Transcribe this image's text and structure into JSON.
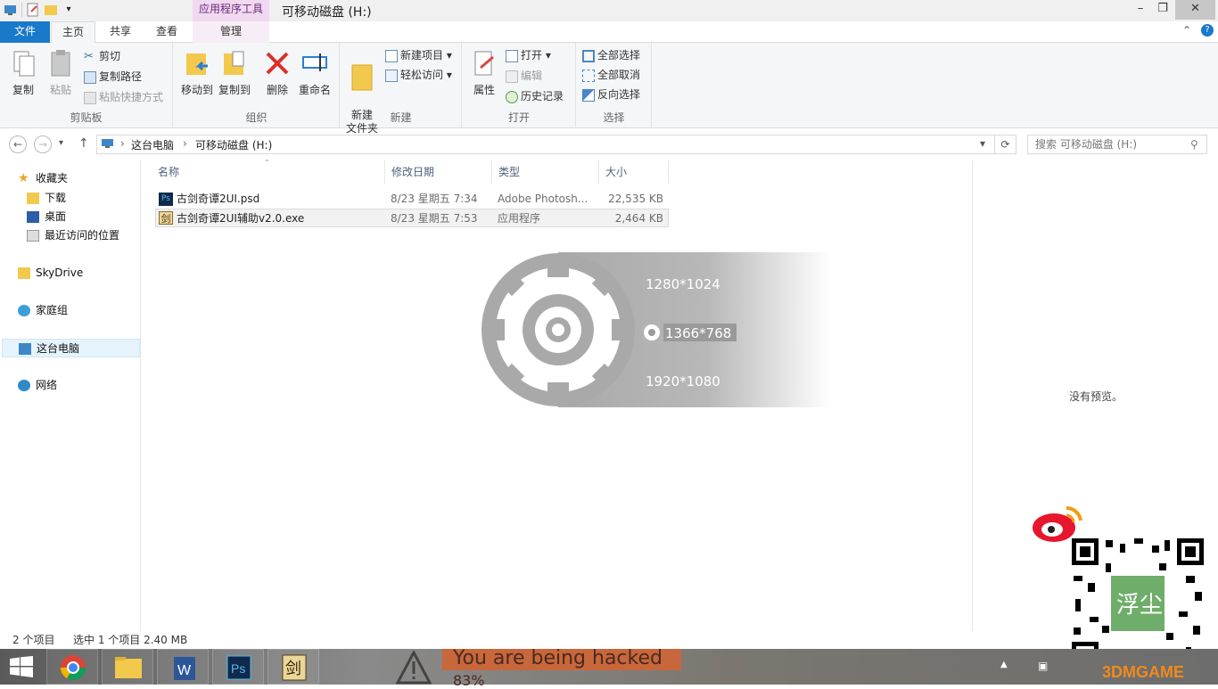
{
  "window": {
    "title": "可移动磁盘 (H:)",
    "context_tab_group": "应用程序工具",
    "minimize": "–",
    "maximize": "❐",
    "close": "✕"
  },
  "tabs": {
    "file": "文件",
    "home": "主页",
    "share": "共享",
    "view": "查看",
    "manage": "管理"
  },
  "ribbon": {
    "clipboard": {
      "label": "剪贴板",
      "copy": "复制",
      "paste": "粘贴",
      "cut": "剪切",
      "copy_path": "复制路径",
      "paste_shortcut": "粘贴快捷方式"
    },
    "organize": {
      "label": "组织",
      "move_to": "移动到",
      "copy_to": "复制到",
      "delete": "删除",
      "rename": "重命名"
    },
    "new": {
      "label": "新建",
      "new_folder": "新建\n文件夹",
      "new_item": "新建项目",
      "easy_access": "轻松访问"
    },
    "open": {
      "label": "打开",
      "properties": "属性",
      "open": "打开",
      "edit": "编辑",
      "history": "历史记录"
    },
    "select": {
      "label": "选择",
      "select_all": "全部选择",
      "select_none": "全部取消",
      "invert": "反向选择"
    }
  },
  "address": {
    "crumb1": "这台电脑",
    "crumb2": "可移动磁盘 (H:)",
    "search_placeholder": "搜索 可移动磁盘 (H:)"
  },
  "nav": {
    "favorites": "收藏夹",
    "downloads": "下载",
    "desktop": "桌面",
    "recent": "最近访问的位置",
    "skydrive": "SkyDrive",
    "homegroup": "家庭组",
    "thispc": "这台电脑",
    "network": "网络"
  },
  "columns": {
    "name": "名称",
    "date": "修改日期",
    "type": "类型",
    "size": "大小"
  },
  "files": [
    {
      "name": "古剑奇谭2UI.psd",
      "date": "8/23 星期五 7:34",
      "type": "Adobe Photosh...",
      "size": "22,535 KB"
    },
    {
      "name": "古剑奇谭2UI辅助v2.0.exe",
      "date": "8/23 星期五 7:53",
      "type": "应用程序",
      "size": "2,464 KB"
    }
  ],
  "overlay": {
    "res1": "1280*1024",
    "res2": "1366*768",
    "res3": "1920*1080"
  },
  "preview": {
    "empty": "没有预览。"
  },
  "status": {
    "count": "2 个项目",
    "selected": "选中 1 个项目  2.40 MB"
  },
  "taskbar": {
    "banner": "You are being hacked",
    "banner_sub": "83%",
    "watermark": "3DMGAME",
    "qr_label": "浮尘"
  },
  "colors": {
    "file_tab": "#1979ca",
    "context_tab": "#f1d9f1",
    "selection": "#e5f3fb"
  }
}
